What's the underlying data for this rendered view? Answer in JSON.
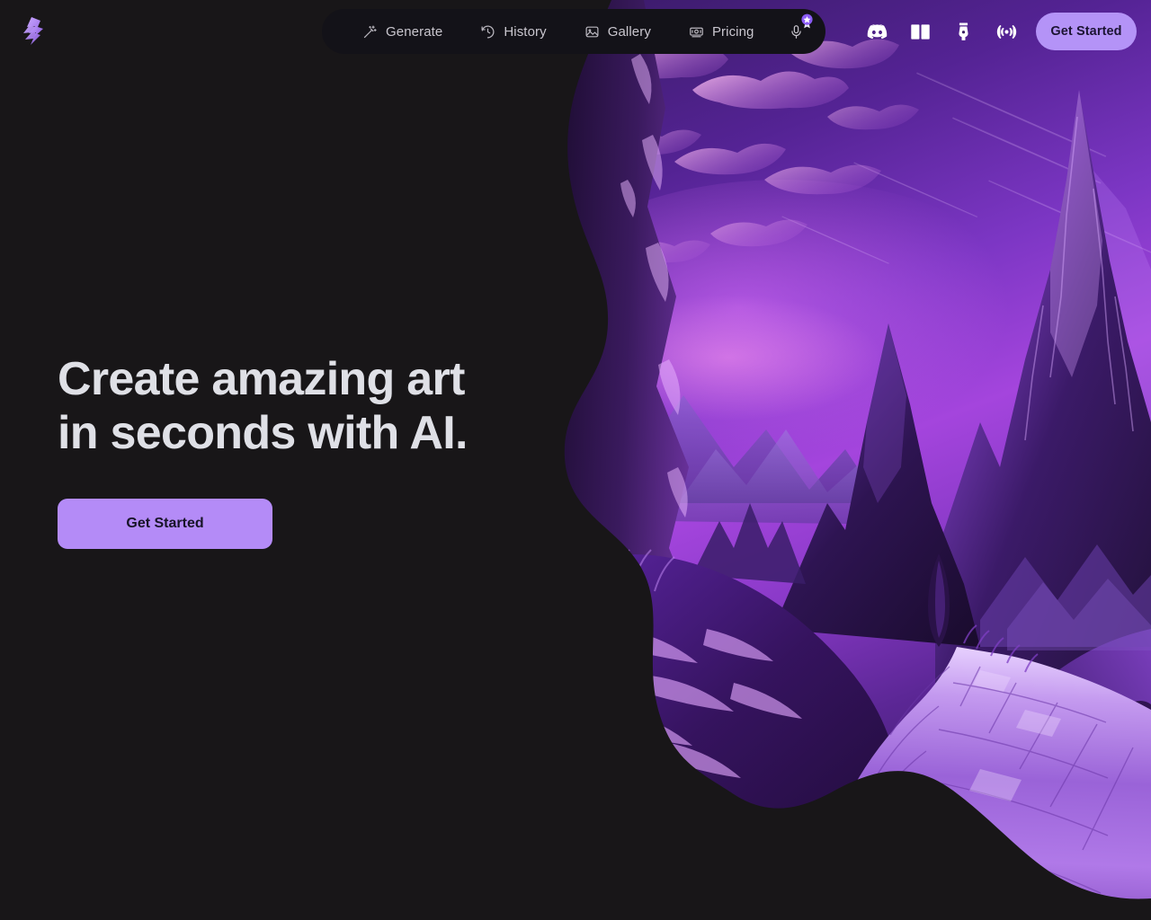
{
  "theme": {
    "page_bg": "#181618",
    "nav_pill_bg": "#131218",
    "accent_purple": "#b48bf7",
    "cta_text": "#171427",
    "nav_text": "#c9c6ce",
    "hero_text": "#dfe0e6"
  },
  "brand": {
    "logo_name": "app-logo"
  },
  "nav": {
    "items": [
      {
        "label": "Generate",
        "icon": "magic-wand-icon"
      },
      {
        "label": "History",
        "icon": "clock-history-icon"
      },
      {
        "label": "Gallery",
        "icon": "image-gallery-icon"
      },
      {
        "label": "Pricing",
        "icon": "banknote-icon"
      }
    ],
    "mic": {
      "icon": "microphone-icon",
      "badge": "award-badge-icon"
    }
  },
  "social_icons": [
    {
      "name": "discord-icon"
    },
    {
      "name": "book-icon"
    },
    {
      "name": "pen-nib-icon"
    },
    {
      "name": "broadcast-icon"
    }
  ],
  "header": {
    "cta_label": "Get Started"
  },
  "hero": {
    "title": "Create amazing art\nin seconds with AI.",
    "cta_label": "Get Started",
    "artwork": {
      "name": "fantasy-purple-mountain-landscape",
      "description": "Purple fantasy landscape with jagged mountain peaks, glowing magenta clouds, a cypress tree and a winding cobblestone path"
    }
  }
}
